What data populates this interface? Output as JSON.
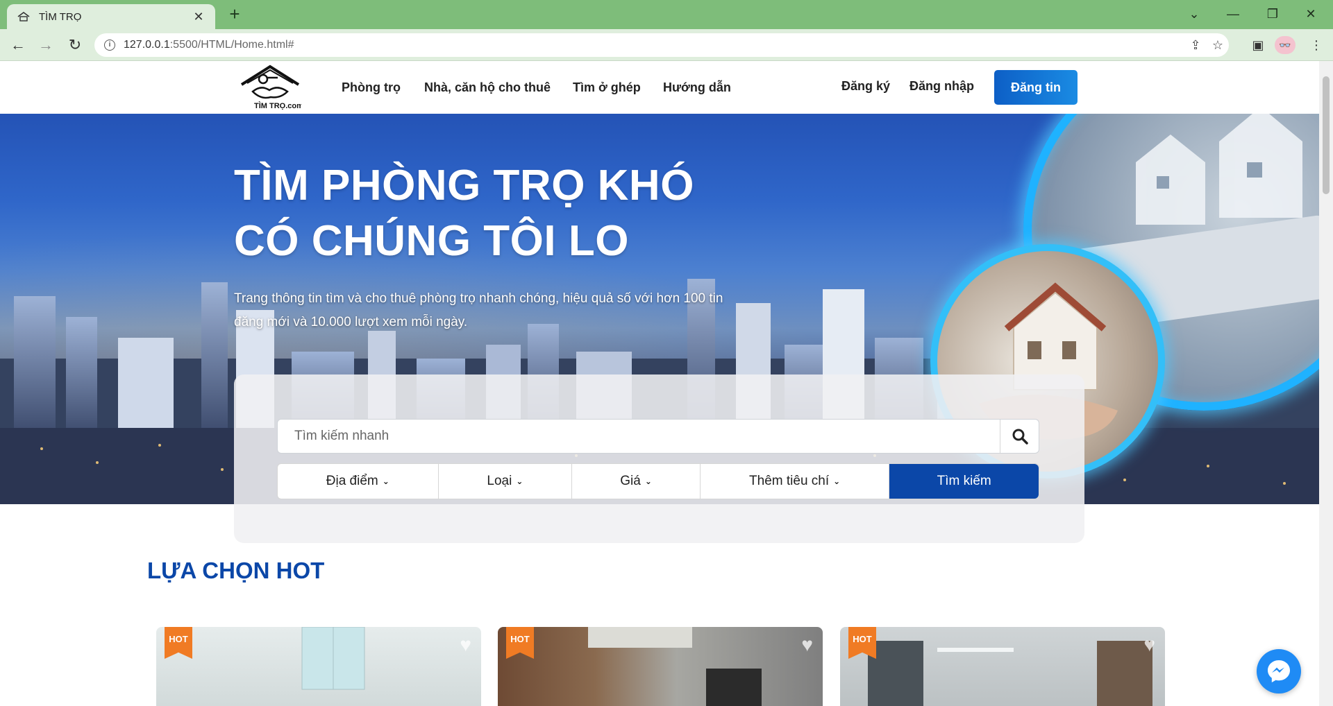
{
  "browser": {
    "tab_title": "TÌM TRỌ",
    "url_host": "127.0.0.1",
    "url_rest": ":5500/HTML/Home.html#"
  },
  "header": {
    "logo_text": "TÌM TRỌ.com",
    "nav": [
      "Phòng trọ",
      "Nhà, căn hộ cho thuê",
      "Tìm ở ghép",
      "Hướng dẫn"
    ],
    "register": "Đăng ký",
    "login": "Đăng nhập",
    "post": "Đăng tin"
  },
  "hero": {
    "title_line1": "TÌM PHÒNG TRỌ KHÓ",
    "title_line2": "CÓ CHÚNG TÔI LO",
    "subtitle": "Trang thông tin tìm và cho thuê phòng trọ nhanh chóng, hiệu quả số với hơn 100 tin đăng mới và 10.000 lượt xem mỗi ngày."
  },
  "search": {
    "placeholder": "Tìm kiếm nhanh",
    "filters": [
      "Địa điểm",
      "Loại",
      "Giá",
      "Thêm tiêu chí"
    ],
    "submit": "Tìm kiếm"
  },
  "hot": {
    "title": "LỰA CHỌN HOT",
    "badge": "HOT"
  },
  "colors": {
    "tabstrip": "#7ebd7a",
    "toolbar": "#dfeedd",
    "primary": "#0b47a8",
    "button_gradient_start": "#0d5fc6",
    "hot_badge": "#f07b24",
    "messenger": "#1f8bf5"
  }
}
